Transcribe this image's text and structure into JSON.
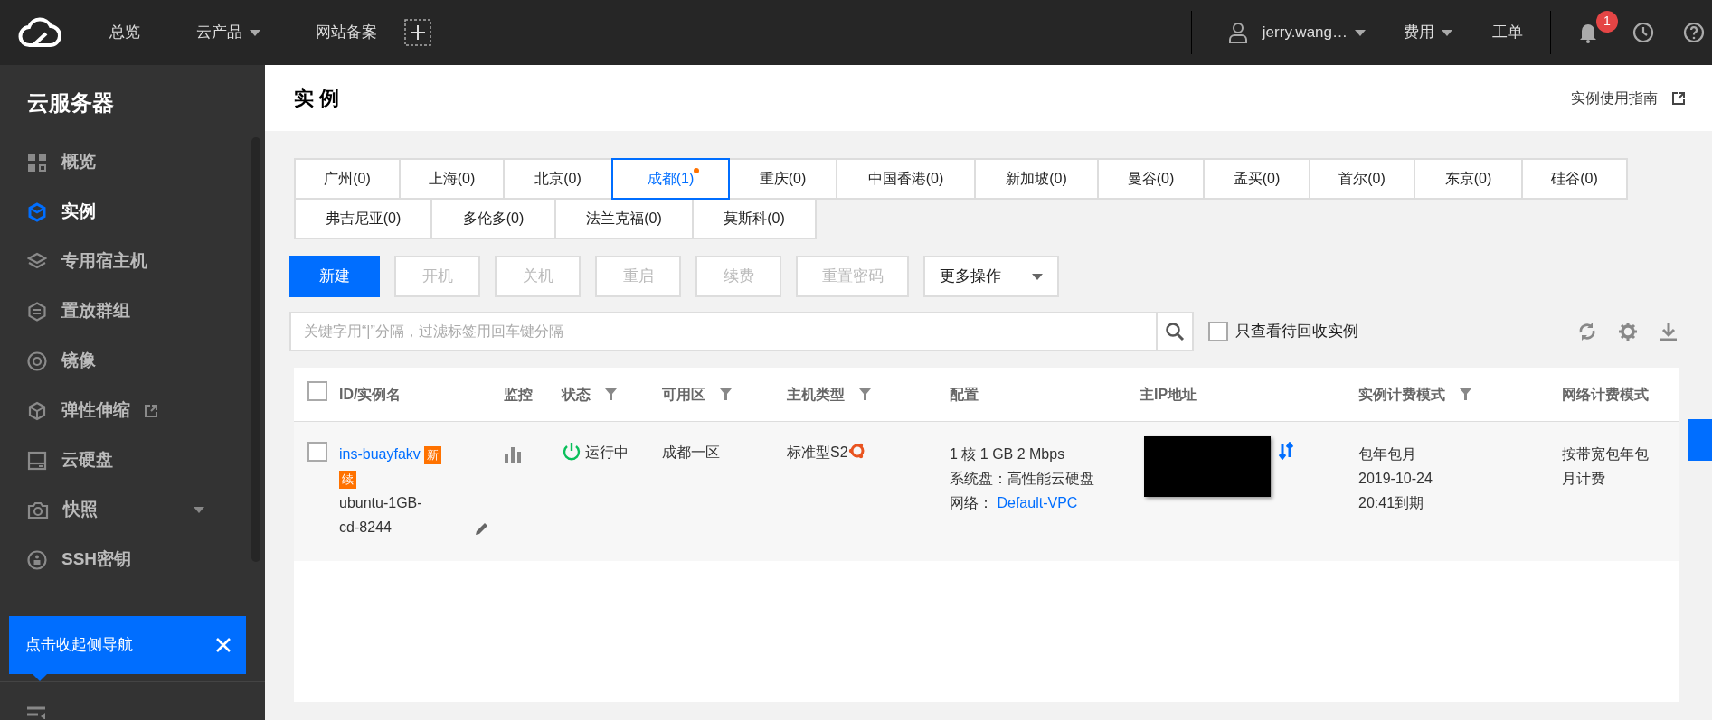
{
  "topbar": {
    "nav": [
      {
        "label": "总览",
        "dropdown": false
      },
      {
        "label": "云产品",
        "dropdown": true
      },
      {
        "label": "网站备案",
        "dropdown": false
      }
    ],
    "user": {
      "label": "jerry.wang…"
    },
    "menus": [
      {
        "label": "费用",
        "dropdown": true
      },
      {
        "label": "工单",
        "dropdown": false
      }
    ],
    "notifications": "1"
  },
  "sidebar": {
    "title": "云服务器",
    "items": [
      {
        "label": "概览",
        "selected": false,
        "external": false,
        "expandable": false
      },
      {
        "label": "实例",
        "selected": true,
        "external": false,
        "expandable": false
      },
      {
        "label": "专用宿主机",
        "selected": false,
        "external": false,
        "expandable": false
      },
      {
        "label": "置放群组",
        "selected": false,
        "external": false,
        "expandable": false
      },
      {
        "label": "镜像",
        "selected": false,
        "external": false,
        "expandable": false
      },
      {
        "label": "弹性伸缩",
        "selected": false,
        "external": true,
        "expandable": false
      },
      {
        "label": "云硬盘",
        "selected": false,
        "external": false,
        "expandable": false
      },
      {
        "label": "快照",
        "selected": false,
        "external": false,
        "expandable": true
      },
      {
        "label": "SSH密钥",
        "selected": false,
        "external": false,
        "expandable": false
      }
    ]
  },
  "tooltip": {
    "text": "点击收起侧导航"
  },
  "page": {
    "title": "实 例",
    "guide_link": "实例使用指南"
  },
  "regions": [
    {
      "label": "广州(0)",
      "selected": false,
      "notice": false
    },
    {
      "label": "上海(0)",
      "selected": false,
      "notice": false
    },
    {
      "label": "北京(0)",
      "selected": false,
      "notice": false
    },
    {
      "label": "成都(1)",
      "selected": true,
      "notice": true
    },
    {
      "label": "重庆(0)",
      "selected": false,
      "notice": false
    },
    {
      "label": "中国香港(0)",
      "selected": false,
      "notice": false
    },
    {
      "label": "新加坡(0)",
      "selected": false,
      "notice": false
    },
    {
      "label": "曼谷(0)",
      "selected": false,
      "notice": false
    },
    {
      "label": "孟买(0)",
      "selected": false,
      "notice": false
    },
    {
      "label": "首尔(0)",
      "selected": false,
      "notice": false
    },
    {
      "label": "东京(0)",
      "selected": false,
      "notice": false
    },
    {
      "label": "硅谷(0)",
      "selected": false,
      "notice": false
    },
    {
      "label": "弗吉尼亚(0)",
      "selected": false,
      "notice": false
    },
    {
      "label": "多伦多(0)",
      "selected": false,
      "notice": false
    },
    {
      "label": "法兰克福(0)",
      "selected": false,
      "notice": false
    },
    {
      "label": "莫斯科(0)",
      "selected": false,
      "notice": false
    }
  ],
  "actions": [
    {
      "label": "新建",
      "kind": "primary",
      "disabled": false
    },
    {
      "label": "开机",
      "kind": "plain",
      "disabled": true
    },
    {
      "label": "关机",
      "kind": "plain",
      "disabled": true
    },
    {
      "label": "重启",
      "kind": "plain",
      "disabled": true
    },
    {
      "label": "续费",
      "kind": "plain",
      "disabled": true
    },
    {
      "label": "重置密码",
      "kind": "plain",
      "disabled": true
    },
    {
      "label": "更多操作",
      "kind": "dropdown",
      "disabled": false
    }
  ],
  "search": {
    "placeholder": "关键字用“|”分隔，过滤标签用回车键分隔"
  },
  "recycle_filter": {
    "label": "只查看待回收实例",
    "checked": false
  },
  "table": {
    "select_all": {
      "checked": false
    },
    "columns": [
      {
        "label": "ID/实例名",
        "filter": false
      },
      {
        "label": "监控",
        "filter": false
      },
      {
        "label": "状态",
        "filter": true
      },
      {
        "label": "可用区",
        "filter": true
      },
      {
        "label": "主机类型",
        "filter": true
      },
      {
        "label": "配置",
        "filter": false
      },
      {
        "label": "主IP地址",
        "filter": false
      },
      {
        "label": "实例计费模式",
        "filter": true
      },
      {
        "label": "网络计费模式",
        "filter": false
      }
    ],
    "rows": [
      {
        "checked": false,
        "id": "ins-buayfakv",
        "tags": [
          "新",
          "续"
        ],
        "name": "ubuntu-1GB-cd-8244",
        "status": "运行中",
        "zone": "成都一区",
        "type": "标准型S2",
        "config": "1 核 1 GB 2 Mbps",
        "disk": "系统盘：高性能云硬盘",
        "network_label": "网络：",
        "network": "Default-VPC",
        "billing": "包年包月",
        "expiry": "2019-10-24 20:41到期",
        "net_billing": "按带宽包年包月计费"
      }
    ]
  }
}
